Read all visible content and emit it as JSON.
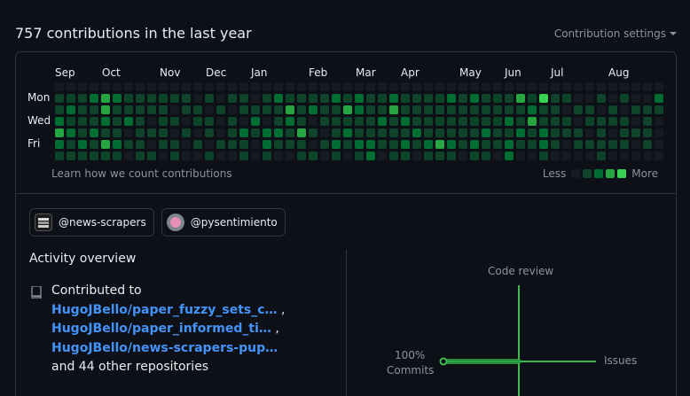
{
  "header": {
    "title": "757 contributions in the last year",
    "settings_label": "Contribution settings"
  },
  "calendar": {
    "months": [
      "Sep",
      "Oct",
      "Nov",
      "Dec",
      "Jan",
      "Feb",
      "Mar",
      "Apr",
      "May",
      "Jun",
      "Jul",
      "Aug"
    ],
    "days": [
      "Mon",
      "Wed",
      "Fri"
    ],
    "learn_link": "Learn how we count contributions",
    "legend_less": "Less",
    "legend_more": "More",
    "colors": [
      "#161b22",
      "#0e4429",
      "#006d32",
      "#26a641",
      "#39d353"
    ],
    "weeks": [
      [
        0,
        1,
        1,
        2,
        3,
        2,
        1
      ],
      [
        0,
        1,
        2,
        1,
        2,
        1,
        1
      ],
      [
        0,
        1,
        1,
        1,
        1,
        2,
        1
      ],
      [
        0,
        2,
        1,
        1,
        2,
        1,
        1
      ],
      [
        0,
        3,
        3,
        2,
        1,
        3,
        1
      ],
      [
        0,
        2,
        1,
        1,
        1,
        2,
        1
      ],
      [
        0,
        1,
        1,
        2,
        0,
        1,
        0
      ],
      [
        0,
        1,
        1,
        1,
        1,
        1,
        1
      ],
      [
        0,
        1,
        1,
        0,
        1,
        0,
        1
      ],
      [
        0,
        1,
        1,
        1,
        1,
        1,
        0
      ],
      [
        0,
        1,
        0,
        1,
        0,
        1,
        1
      ],
      [
        0,
        1,
        1,
        0,
        1,
        0,
        0
      ],
      [
        0,
        0,
        1,
        1,
        0,
        1,
        0
      ],
      [
        0,
        1,
        0,
        1,
        1,
        0,
        1
      ],
      [
        0,
        0,
        1,
        0,
        0,
        1,
        0
      ],
      [
        0,
        1,
        0,
        1,
        1,
        1,
        0
      ],
      [
        0,
        1,
        1,
        0,
        2,
        1,
        1
      ],
      [
        0,
        0,
        1,
        2,
        1,
        0,
        0
      ],
      [
        0,
        1,
        1,
        0,
        2,
        2,
        1
      ],
      [
        0,
        2,
        1,
        1,
        2,
        1,
        0
      ],
      [
        0,
        1,
        3,
        2,
        1,
        1,
        0
      ],
      [
        0,
        1,
        1,
        1,
        3,
        1,
        1
      ],
      [
        0,
        1,
        2,
        0,
        1,
        0,
        1
      ],
      [
        0,
        1,
        1,
        1,
        0,
        1,
        0
      ],
      [
        0,
        2,
        1,
        1,
        1,
        2,
        1
      ],
      [
        0,
        1,
        3,
        1,
        2,
        1,
        0
      ],
      [
        0,
        2,
        2,
        1,
        1,
        2,
        1
      ],
      [
        0,
        1,
        1,
        1,
        1,
        2,
        2
      ],
      [
        0,
        1,
        1,
        2,
        1,
        1,
        0
      ],
      [
        0,
        2,
        3,
        1,
        1,
        1,
        1
      ],
      [
        0,
        1,
        1,
        2,
        1,
        2,
        1
      ],
      [
        0,
        1,
        1,
        1,
        2,
        1,
        0
      ],
      [
        0,
        1,
        1,
        1,
        1,
        2,
        1
      ],
      [
        0,
        1,
        1,
        1,
        1,
        3,
        1
      ],
      [
        0,
        2,
        1,
        1,
        1,
        2,
        1
      ],
      [
        0,
        1,
        1,
        1,
        1,
        1,
        0
      ],
      [
        0,
        2,
        1,
        1,
        1,
        2,
        1
      ],
      [
        0,
        1,
        1,
        1,
        2,
        1,
        1
      ],
      [
        0,
        1,
        1,
        1,
        1,
        1,
        0
      ],
      [
        0,
        1,
        1,
        2,
        1,
        2,
        2
      ],
      [
        0,
        3,
        1,
        1,
        2,
        1,
        0
      ],
      [
        0,
        1,
        2,
        3,
        1,
        1,
        0
      ],
      [
        0,
        4,
        1,
        1,
        2,
        2,
        1
      ],
      [
        0,
        1,
        1,
        1,
        1,
        1,
        0
      ],
      [
        0,
        1,
        0,
        1,
        1,
        0,
        0
      ],
      [
        0,
        0,
        1,
        0,
        1,
        1,
        0
      ],
      [
        0,
        0,
        1,
        1,
        0,
        1,
        0
      ],
      [
        0,
        1,
        0,
        1,
        1,
        1,
        1
      ],
      [
        0,
        0,
        1,
        1,
        0,
        1,
        0
      ],
      [
        0,
        1,
        0,
        1,
        1,
        1,
        0
      ],
      [
        0,
        0,
        1,
        0,
        1,
        0,
        0
      ],
      [
        0,
        0,
        1,
        1,
        1,
        1,
        0
      ],
      [
        0,
        2,
        1,
        0,
        0,
        0,
        0
      ]
    ]
  },
  "organizations": [
    {
      "label": "@news-scrapers"
    },
    {
      "label": "@pysentimiento"
    }
  ],
  "activity": {
    "title": "Activity overview",
    "contributed_to": "Contributed to",
    "repos": [
      "HugoJBello/paper_fuzzy_sets_c…",
      "HugoJBello/paper_informed_ti…",
      "HugoJBello/news-scrapers-pup…"
    ],
    "comma": ",",
    "other": "and 44 other repositories"
  },
  "overview_chart": {
    "code_review": "Code review",
    "issues": "Issues",
    "commits_pct": "100%",
    "commits": "Commits",
    "commits_percent": 100,
    "axis_color": "#3fb950"
  }
}
